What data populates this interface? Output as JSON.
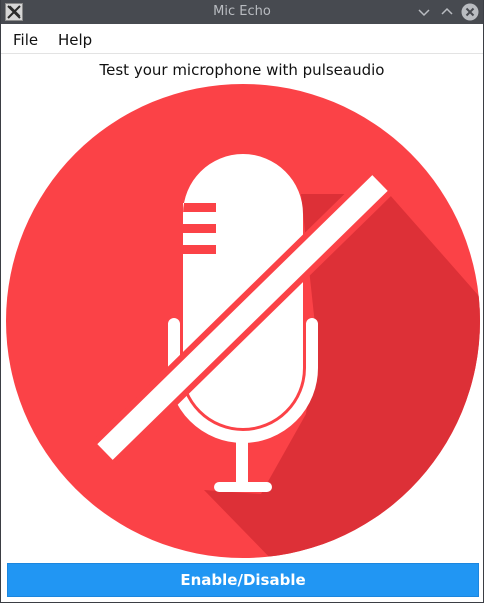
{
  "window": {
    "title": "Mic Echo",
    "icon": "x-window-icon",
    "controls": {
      "minimize_icon": "chevron-down-icon",
      "maximize_icon": "chevron-up-icon",
      "close_icon": "close-icon"
    }
  },
  "menubar": {
    "items": [
      {
        "label": "File"
      },
      {
        "label": "Help"
      }
    ]
  },
  "main": {
    "instruction": "Test your microphone with pulseaudio",
    "status_image": {
      "icon": "microphone-muted-icon",
      "colors": {
        "circle": "#fb4247",
        "shadow": "#dd3037",
        "glyph": "#ffffff"
      }
    },
    "toggle_button": {
      "label": "Enable/Disable",
      "color": "#2196f3"
    }
  }
}
